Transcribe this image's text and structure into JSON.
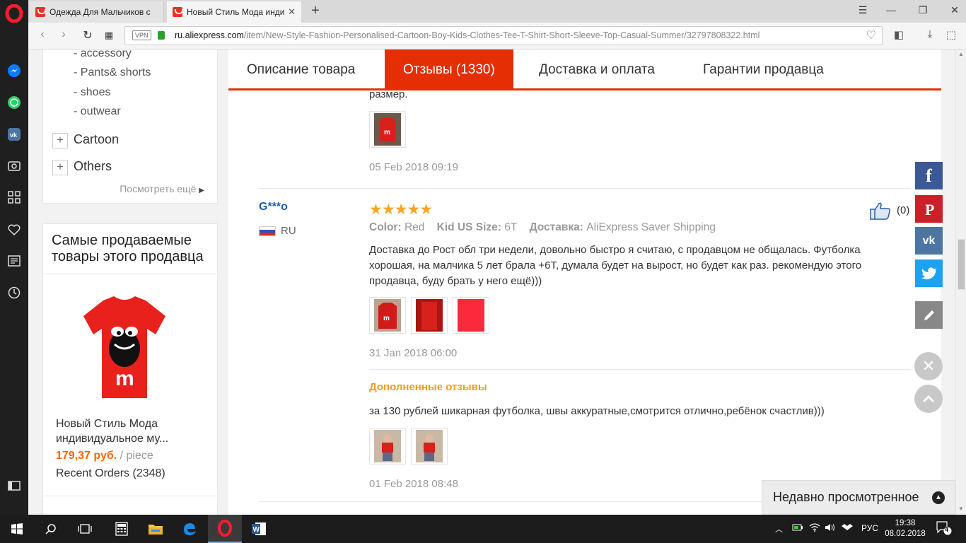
{
  "browser": {
    "tabs": [
      {
        "title": "Одежда Для Мальчиков с"
      },
      {
        "title": "Новый Стиль Мода инди"
      }
    ],
    "address": {
      "vpn": "VPN",
      "host": "ru.aliexpress.com",
      "path": "/item/New-Style-Fashion-Personalised-Cartoon-Boy-Kids-Clothes-Tee-T-Shirt-Short-Sleeve-Top-Casual-Summer/32797808322.html"
    }
  },
  "categories": {
    "subitems": [
      "- accessory",
      "- Pants& shorts",
      "- shoes",
      "- outwear"
    ],
    "items": [
      "Cartoon",
      "Others"
    ],
    "see_more": "Посмотреть ещё"
  },
  "bestsellers": {
    "title": "Самые продаваемые товары этого продавца",
    "product": {
      "name": "Новый Стиль Мода индивидуальное му...",
      "price": "179,37 руб.",
      "unit": "/ piece",
      "orders": "Recent Orders (2348)"
    }
  },
  "product_tabs": [
    "Описание товара",
    "Отзывы (1330)",
    "Доставка и оплата",
    "Гарантии продавца"
  ],
  "prev_review": {
    "text_tail": "размер.",
    "date": "05 Feb 2018 09:19"
  },
  "review": {
    "user": "G***o",
    "country": "RU",
    "stars": 5,
    "stars_text": "★★★★★",
    "likes": "(0)",
    "attrs": {
      "color_label": "Color:",
      "color_value": "Red",
      "size_label": "Kid US Size:",
      "size_value": "6T",
      "shipping_label": "Доставка:",
      "shipping_value": "AliExpress Saver Shipping"
    },
    "text": "Доставка до Рост обл три недели, довольно быстро я считаю, с продавцом не общалась. Футболка хорошая, на малчика 5 лет брала +6Т, думала будет на вырост, но будет как раз. рекомендую этого продавца, буду брать у него ещё)))",
    "date": "31 Jan 2018 06:00",
    "additional": {
      "title": "Дополненные отзывы",
      "text": "за 130 рублей шикарная футболка, швы аккуратные,смотрится отлично,ребёнок счастлив)))",
      "date": "01 Feb 2018 08:48"
    }
  },
  "recently_viewed": "Недавно просмотренное",
  "taskbar": {
    "lang": "РУС",
    "time": "19:38",
    "date": "08.02.2018",
    "notifications": "4"
  },
  "colors": {
    "accent": "#e62e04",
    "link": "#1b5aa6",
    "price": "#ff6600",
    "stars": "#f5a623",
    "facebook": "#3b5998",
    "pinterest": "#cb2027",
    "vk": "#4c75a3",
    "twitter": "#1da1f2"
  }
}
